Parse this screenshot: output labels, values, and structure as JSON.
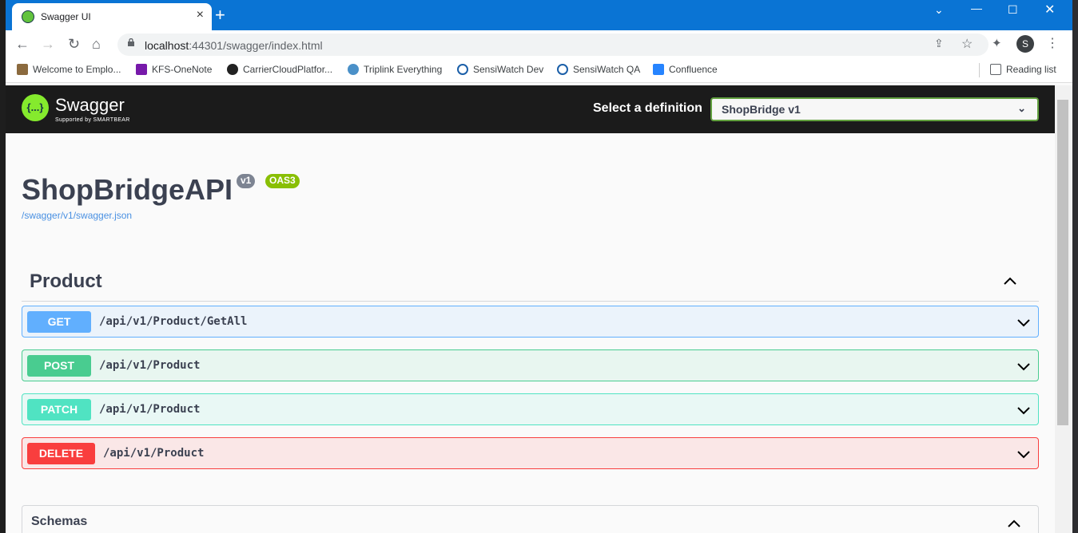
{
  "browser": {
    "tab_title": "Swagger UI",
    "url_host": "localhost",
    "url_rest": ":44301/swagger/index.html",
    "profile_initial": "S",
    "bookmarks": [
      "Welcome to Emplo...",
      "KFS-OneNote",
      "CarrierCloudPlatfor...",
      "Triplink Everything",
      "SensiWatch Dev",
      "SensiWatch QA",
      "Confluence"
    ],
    "reading_list": "Reading list"
  },
  "swagger": {
    "logo_name": "Swagger",
    "logo_sub": "Supported by SMARTBEAR",
    "definition_label": "Select a definition",
    "definition_value": "ShopBridge v1",
    "api_title": "ShopBridgeAPI",
    "version_badge": "v1",
    "oas_badge": "OAS3",
    "spec_link": "/swagger/v1/swagger.json",
    "tag": "Product",
    "operations": [
      {
        "method": "GET",
        "path": "/api/v1/Product/GetAll"
      },
      {
        "method": "POST",
        "path": "/api/v1/Product"
      },
      {
        "method": "PATCH",
        "path": "/api/v1/Product"
      },
      {
        "method": "DELETE",
        "path": "/api/v1/Product"
      }
    ],
    "schemas_title": "Schemas"
  },
  "colors": {
    "get": "#61affe",
    "post": "#49cc90",
    "patch": "#50e3c2",
    "delete": "#f93e3e",
    "accent": "#85ea2d"
  }
}
